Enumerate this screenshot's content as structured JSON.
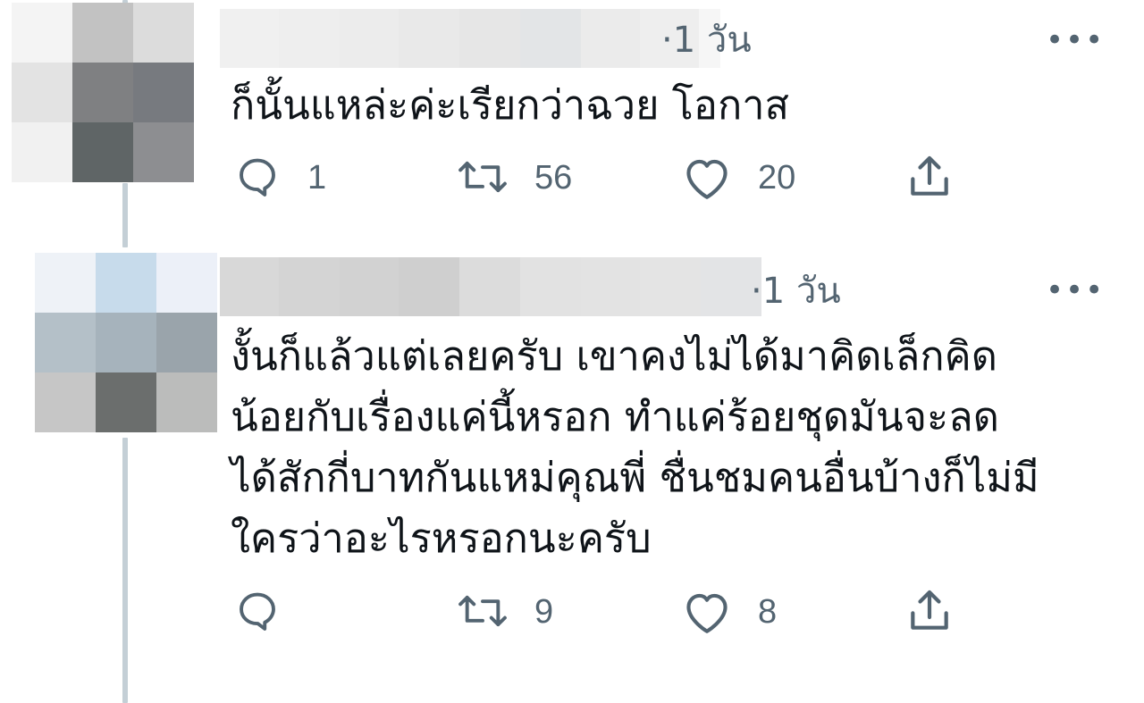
{
  "tweets": [
    {
      "time": "·1 วัน",
      "more": "•••",
      "text": "ก็นั้นแหล่ะค่ะเรียกว่าฉวย โอกาส",
      "replies": "1",
      "retweets": "56",
      "likes": "20"
    },
    {
      "time": "·1 วัน",
      "more": "•••",
      "text_lines": [
        "งั้นก็แล้วแต่เลยครับ เขาคงไม่ได้มาคิดเล็กคิด",
        "น้อยกับเรื่องแค่นี้หรอก ทำแค่ร้อยชุดมันจะลด",
        "ได้สักกี่บาทกันแหม่คุณพี่ ชื่นชมคนอื่นบ้างก็ไม่มี",
        "ใครว่าอะไรหรอกนะครับ"
      ],
      "replies": "",
      "retweets": "9",
      "likes": "8"
    }
  ],
  "icons": {
    "reply": "reply-icon",
    "retweet": "retweet-icon",
    "like": "heart-icon",
    "share": "share-icon",
    "more": "more-icon"
  },
  "colors": {
    "text": "#0f1419",
    "muted": "#536471",
    "thread": "#c4cfd6"
  }
}
